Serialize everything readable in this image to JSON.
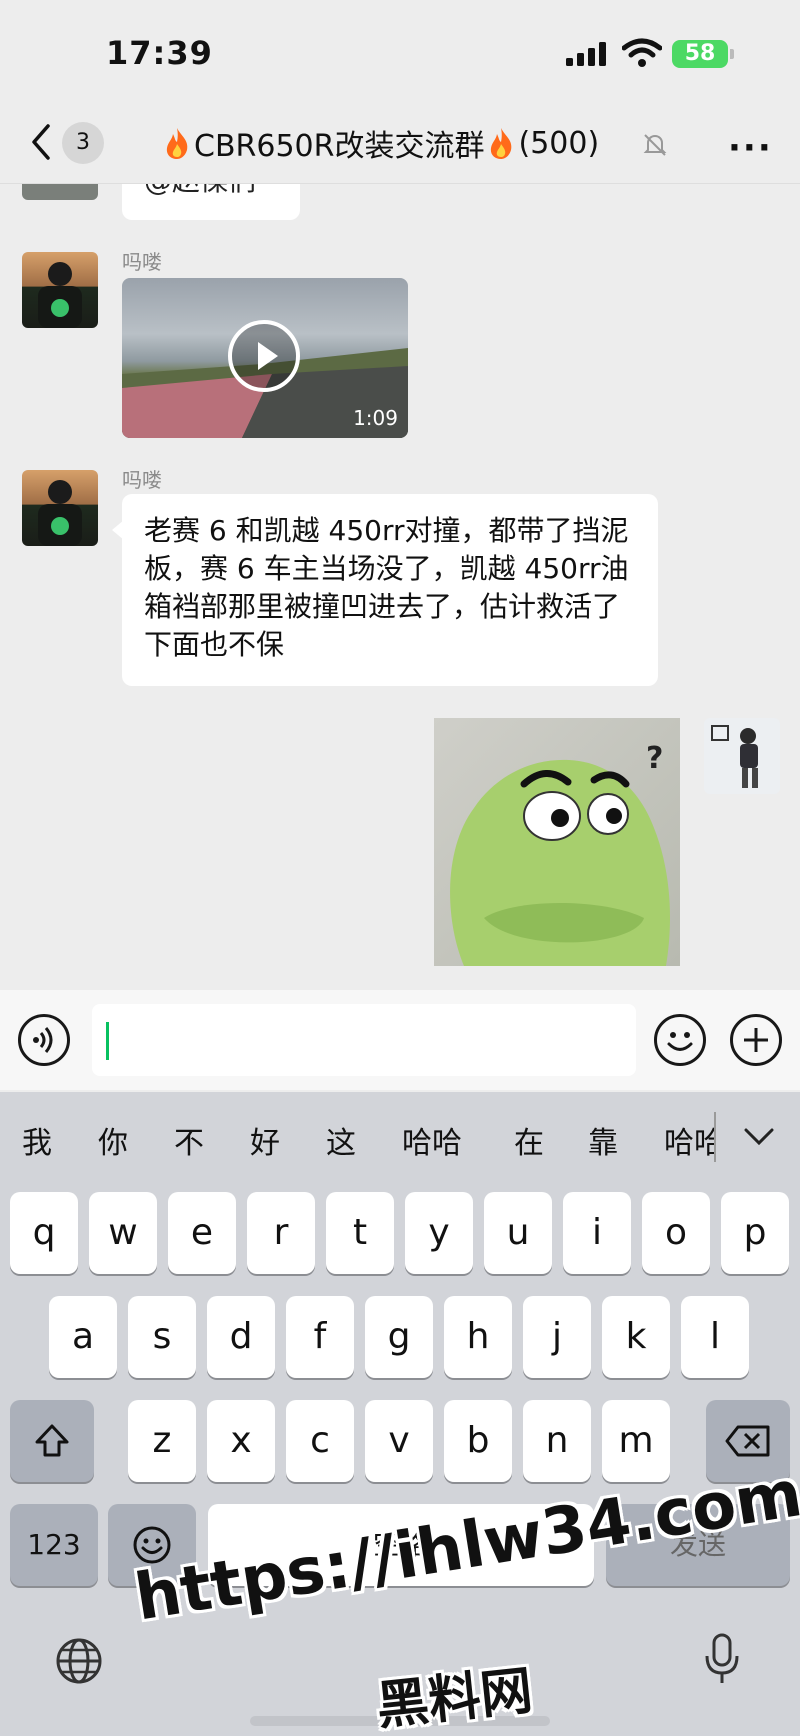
{
  "status_bar": {
    "time": "17:39",
    "battery": "58"
  },
  "nav": {
    "unread_count": "3",
    "title": "CBR650R改装交流群",
    "member_count": "(500)"
  },
  "chat": {
    "partial_text": "@赵傈们",
    "messages": [
      {
        "sender": "吗喽",
        "type": "video",
        "duration": "1:09"
      },
      {
        "sender": "吗喽",
        "type": "text",
        "text": "老赛 6 和凯越 450rr对撞，都带了挡泥板，赛 6 车主当场没了，凯越 450rr油箱裆部那里被撞凹进去了，估计救活了下面也不保"
      },
      {
        "sender": "",
        "type": "sticker",
        "self": true
      }
    ]
  },
  "keyboard": {
    "candidates": [
      "我",
      "你",
      "不",
      "好",
      "这",
      "哈哈",
      "在",
      "靠",
      "哈哈"
    ],
    "row1": [
      "q",
      "w",
      "e",
      "r",
      "t",
      "y",
      "u",
      "i",
      "o",
      "p"
    ],
    "row2": [
      "a",
      "s",
      "d",
      "f",
      "g",
      "h",
      "j",
      "k",
      "l"
    ],
    "row3": [
      "z",
      "x",
      "c",
      "v",
      "b",
      "n",
      "m"
    ],
    "numbers_label": "123",
    "space_label": "空格",
    "send_label": "发送"
  },
  "watermark": {
    "url": "https://ihlw34.com",
    "site": "黑料网"
  },
  "colors": {
    "accent": "#07c160",
    "battery": "#4cd964",
    "bubble_self": "#95ec69"
  }
}
